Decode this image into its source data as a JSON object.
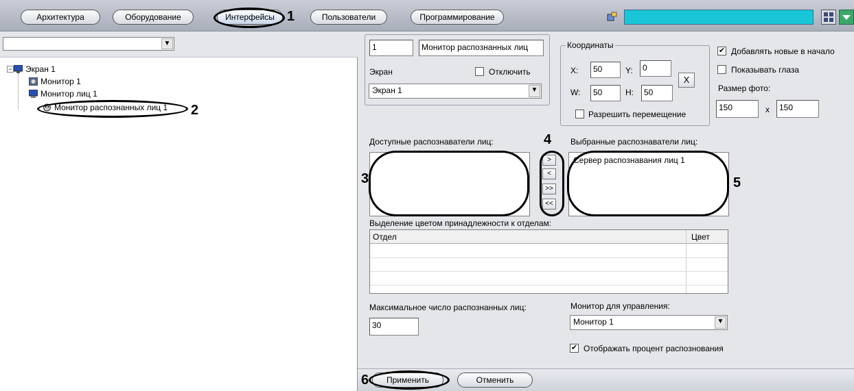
{
  "toolbar": {
    "tabs": [
      "Архитектура",
      "Оборудование",
      "Интерфейсы",
      "Пользователи",
      "Программирование"
    ],
    "active_tab": "Интерфейсы"
  },
  "callouts": [
    "1",
    "2",
    "3",
    "4",
    "5",
    "6"
  ],
  "tree": {
    "root": "Экран 1",
    "children": [
      "Монитор 1",
      "Монитор лиц 1",
      "Монитор распознанных лиц 1"
    ]
  },
  "settings": {
    "id_value": "1",
    "name_value": "Монитор распознанных лиц",
    "screen_label": "Экран",
    "disable_label": "Отключить",
    "screen_value": "Экран 1",
    "coords_title": "Координаты",
    "x_label": "X:",
    "x_value": "50",
    "y_label": "Y:",
    "y_value": "0",
    "w_label": "W:",
    "w_value": "50",
    "h_label": "H:",
    "h_value": "50",
    "coord_reset_label": "X",
    "allow_move_label": "Разрешить перемещение",
    "add_new_first_label": "Добавлять новые в начало",
    "show_eyes_label": "Показывать глаза",
    "photo_size_label": "Размер фото:",
    "photo_w": "150",
    "photo_x_sep": "x",
    "photo_h": "150",
    "available_label": "Доступные распознаватели лиц:",
    "selected_label": "Выбранные распознаватели лиц:",
    "selected_items": [
      "Сервер распознавания лиц 1"
    ],
    "move_buttons": [
      ">",
      "<",
      ">>",
      "<<"
    ],
    "dept_color_label": "Выделение цветом принадлежности к отделам:",
    "dept_columns": [
      "Отдел",
      "Цвет"
    ],
    "max_faces_label": "Максимальное число распознанных лиц:",
    "max_faces_value": "30",
    "control_monitor_label": "Монитор для управления:",
    "control_monitor_value": "Монитор 1",
    "show_percent_label": "Отображать процент распознования"
  },
  "footer": {
    "apply_label": "Применить",
    "cancel_label": "Отменить"
  },
  "colors": {
    "toolbar_bg": "#b9bec9",
    "panel_bg": "#e4e6ea",
    "search_bar": "#19c6d8"
  }
}
